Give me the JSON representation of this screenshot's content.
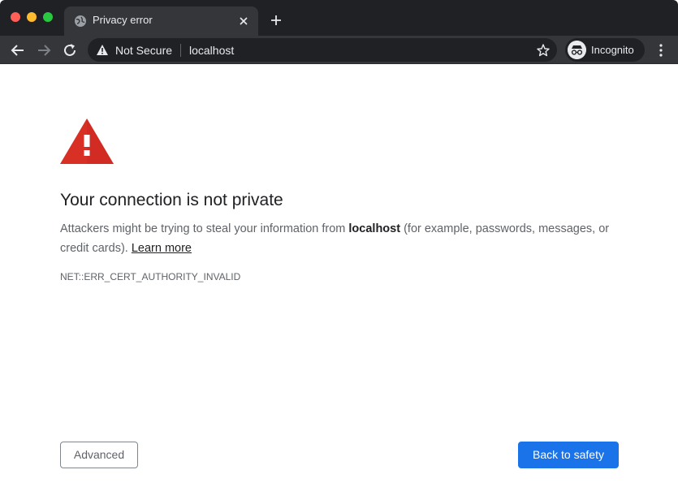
{
  "tab": {
    "title": "Privacy error"
  },
  "omnibox": {
    "security_label": "Not Secure",
    "url": "localhost"
  },
  "profile": {
    "label": "Incognito"
  },
  "page": {
    "heading": "Your connection is not private",
    "desc_pre": "Attackers might be trying to steal your information from ",
    "desc_host": "localhost",
    "desc_post": " (for example, passwords, messages, or credit cards). ",
    "learn_more": "Learn more",
    "error_code": "NET::ERR_CERT_AUTHORITY_INVALID"
  },
  "buttons": {
    "advanced": "Advanced",
    "back_to_safety": "Back to safety"
  },
  "colors": {
    "primary_blue": "#1a73e8",
    "warning_red": "#d93025",
    "chrome_dark": "#202124"
  }
}
